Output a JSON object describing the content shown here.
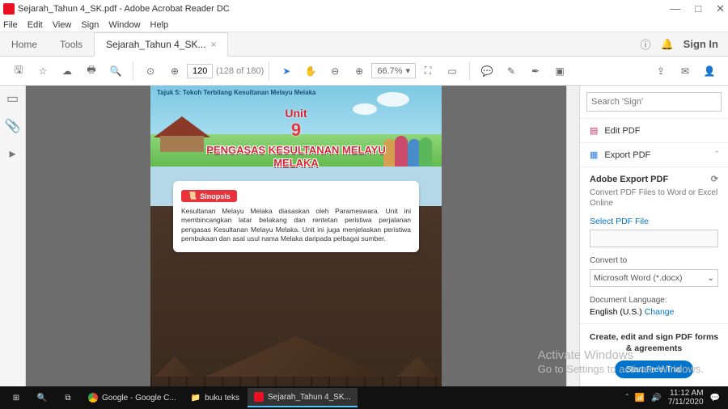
{
  "title": "Sejarah_Tahun 4_SK.pdf - Adobe Acrobat Reader DC",
  "menus": [
    "File",
    "Edit",
    "View",
    "Sign",
    "Window",
    "Help"
  ],
  "tabs": {
    "home": "Home",
    "tools": "Tools",
    "doc": "Sejarah_Tahun 4_SK...",
    "signin": "Sign In"
  },
  "toolbar": {
    "page": "120",
    "total": "(128 of 180)",
    "zoom": "66.7%"
  },
  "doc": {
    "tajuk": "Tajuk 5: Tokoh Terbilang Kesultanan Melayu Melaka",
    "unit_label": "Unit",
    "unit_num": "9",
    "banner": "PENGASAS KESULTANAN MELAYU MELAKA",
    "sinop_label": "Sinopsis",
    "sinop_text": "Kesultanan Melayu Melaka diasaskan oleh Parameswara. Unit ini membincangkan latar belakang dan rentetan peristiwa perjalanan pengasas Kesultanan Melayu Melaka. Unit ini juga menjelaskan peristiwa pembukaan dan asal usul nama Melaka daripada pelbagai sumber."
  },
  "panel": {
    "search_ph": "Search 'Sign'",
    "edit": "Edit PDF",
    "export": "Export PDF",
    "title": "Adobe Export PDF",
    "desc": "Convert PDF Files to Word or Excel Online",
    "select": "Select PDF File",
    "convert": "Convert to",
    "format": "Microsoft Word (*.docx)",
    "lang_label": "Document Language:",
    "lang": "English (U.S.)",
    "change": "Change",
    "cta_title": "Create, edit and sign PDF forms & agreements",
    "cta_btn": "Start Free Trial"
  },
  "taskbar": {
    "chrome": "Google - Google C...",
    "folder": "buku teks",
    "pdf": "Sejarah_Tahun 4_SK...",
    "time": "11:12 AM",
    "date": "7/11/2020"
  },
  "watermark": {
    "l1": "Activate Windows",
    "l2": "Go to Settings to activate Windows."
  }
}
